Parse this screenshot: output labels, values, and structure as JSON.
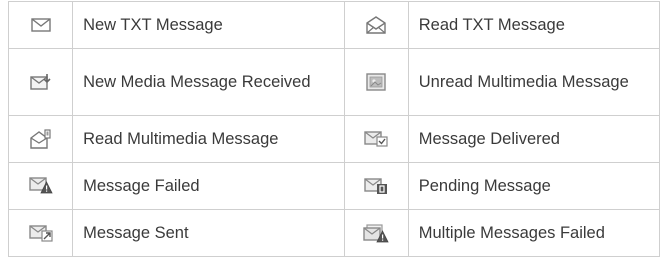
{
  "rows": [
    {
      "left": {
        "icon": "envelope-icon",
        "label": "New TXT Message"
      },
      "right": {
        "icon": "envelope-open-icon",
        "label": "Read TXT Message"
      }
    },
    {
      "left": {
        "icon": "media-message-received-icon",
        "label": "New Media Message Received"
      },
      "right": {
        "icon": "unread-multimedia-icon",
        "label": "Unread Multimedia Message"
      }
    },
    {
      "left": {
        "icon": "read-multimedia-icon",
        "label": "Read Multimedia Message"
      },
      "right": {
        "icon": "message-delivered-icon",
        "label": "Message Delivered"
      }
    },
    {
      "left": {
        "icon": "message-failed-icon",
        "label": "Message Failed"
      },
      "right": {
        "icon": "pending-message-icon",
        "label": "Pending Message"
      }
    },
    {
      "left": {
        "icon": "message-sent-icon",
        "label": "Message Sent"
      },
      "right": {
        "icon": "multiple-messages-failed-icon",
        "label": "Multiple Messages Failed"
      }
    }
  ]
}
